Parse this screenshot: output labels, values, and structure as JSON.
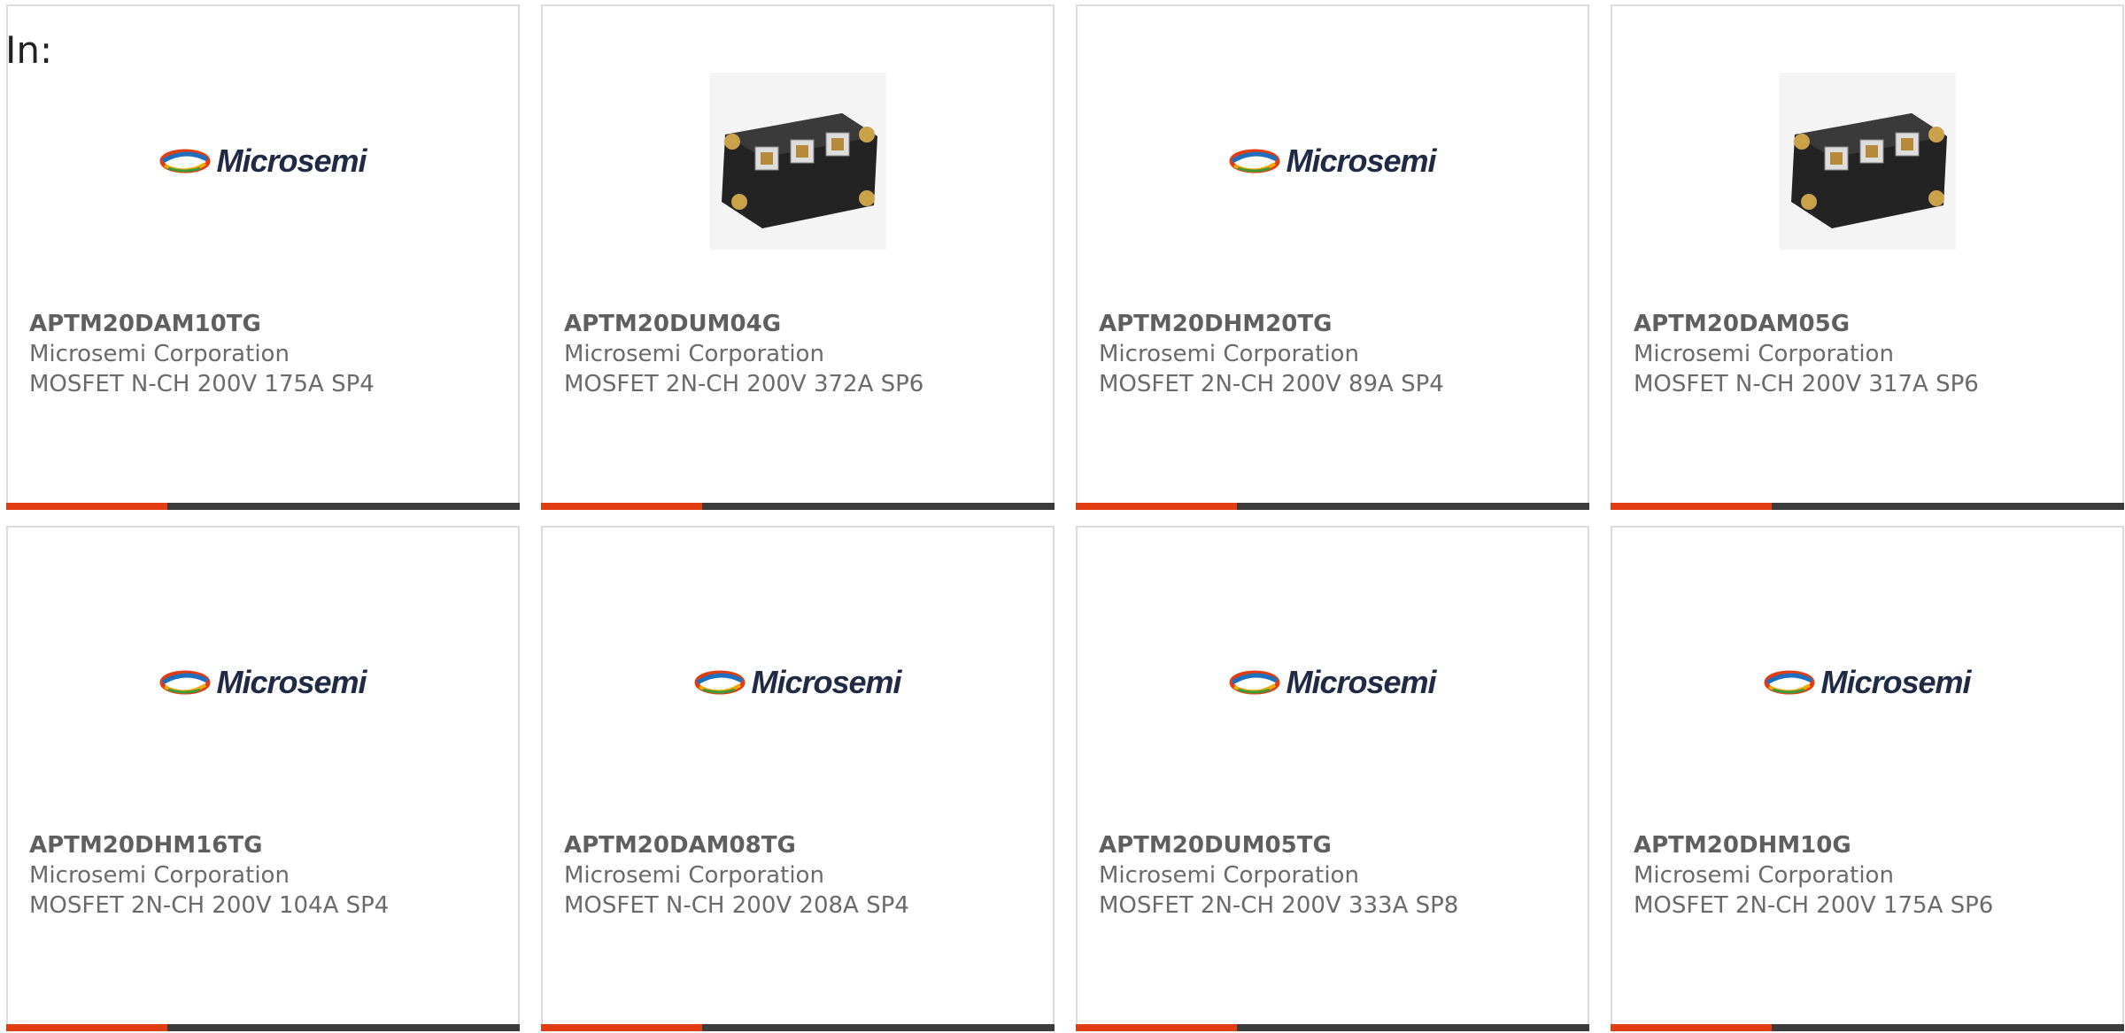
{
  "page": {
    "prefix_label": "In:"
  },
  "colors": {
    "accent_bar": "#e23d12",
    "dark_bar": "#3b3b3b",
    "card_border": "#dcdcdc"
  },
  "logo_text": "Microsemi",
  "products": [
    {
      "part_number": "APTM20DAM10TG",
      "manufacturer": "Microsemi Corporation",
      "description": "MOSFET N-CH 200V 175A SP4",
      "image": "microsemi-logo"
    },
    {
      "part_number": "APTM20DUM04G",
      "manufacturer": "Microsemi Corporation",
      "description": "MOSFET 2N-CH 200V 372A SP6",
      "image": "module-photo"
    },
    {
      "part_number": "APTM20DHM20TG",
      "manufacturer": "Microsemi Corporation",
      "description": "MOSFET 2N-CH 200V 89A SP4",
      "image": "microsemi-logo"
    },
    {
      "part_number": "APTM20DAM05G",
      "manufacturer": "Microsemi Corporation",
      "description": "MOSFET N-CH 200V 317A SP6",
      "image": "module-photo"
    },
    {
      "part_number": "APTM20DHM16TG",
      "manufacturer": "Microsemi Corporation",
      "description": "MOSFET 2N-CH 200V 104A SP4",
      "image": "microsemi-logo"
    },
    {
      "part_number": "APTM20DAM08TG",
      "manufacturer": "Microsemi Corporation",
      "description": "MOSFET N-CH 200V 208A SP4",
      "image": "microsemi-logo"
    },
    {
      "part_number": "APTM20DUM05TG",
      "manufacturer": "Microsemi Corporation",
      "description": "MOSFET 2N-CH 200V 333A SP8",
      "image": "microsemi-logo"
    },
    {
      "part_number": "APTM20DHM10G",
      "manufacturer": "Microsemi Corporation",
      "description": "MOSFET 2N-CH 200V 175A SP6",
      "image": "microsemi-logo"
    }
  ]
}
